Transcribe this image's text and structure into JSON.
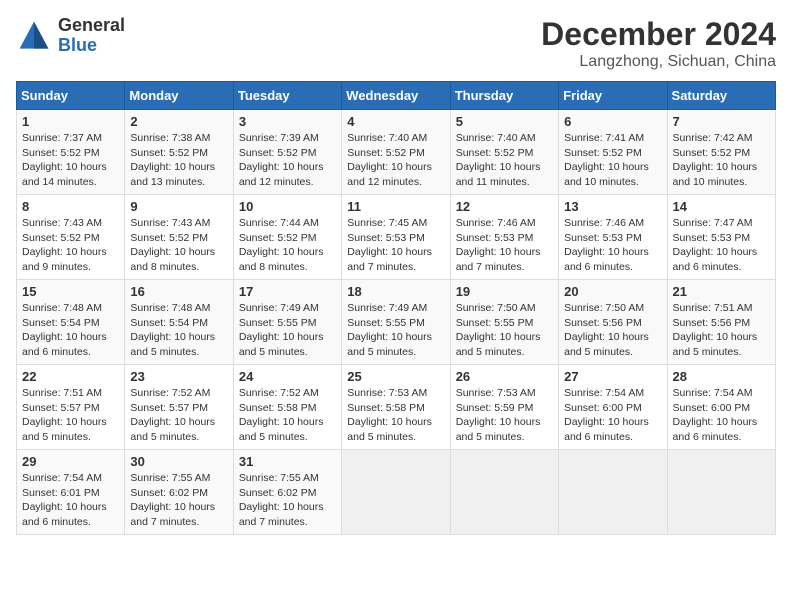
{
  "header": {
    "logo_general": "General",
    "logo_blue": "Blue",
    "month_title": "December 2024",
    "location": "Langzhong, Sichuan, China"
  },
  "weekdays": [
    "Sunday",
    "Monday",
    "Tuesday",
    "Wednesday",
    "Thursday",
    "Friday",
    "Saturday"
  ],
  "weeks": [
    [
      {
        "day": "1",
        "sunrise": "7:37 AM",
        "sunset": "5:52 PM",
        "daylight": "10 hours and 14 minutes."
      },
      {
        "day": "2",
        "sunrise": "7:38 AM",
        "sunset": "5:52 PM",
        "daylight": "10 hours and 13 minutes."
      },
      {
        "day": "3",
        "sunrise": "7:39 AM",
        "sunset": "5:52 PM",
        "daylight": "10 hours and 12 minutes."
      },
      {
        "day": "4",
        "sunrise": "7:40 AM",
        "sunset": "5:52 PM",
        "daylight": "10 hours and 12 minutes."
      },
      {
        "day": "5",
        "sunrise": "7:40 AM",
        "sunset": "5:52 PM",
        "daylight": "10 hours and 11 minutes."
      },
      {
        "day": "6",
        "sunrise": "7:41 AM",
        "sunset": "5:52 PM",
        "daylight": "10 hours and 10 minutes."
      },
      {
        "day": "7",
        "sunrise": "7:42 AM",
        "sunset": "5:52 PM",
        "daylight": "10 hours and 10 minutes."
      }
    ],
    [
      {
        "day": "8",
        "sunrise": "7:43 AM",
        "sunset": "5:52 PM",
        "daylight": "10 hours and 9 minutes."
      },
      {
        "day": "9",
        "sunrise": "7:43 AM",
        "sunset": "5:52 PM",
        "daylight": "10 hours and 8 minutes."
      },
      {
        "day": "10",
        "sunrise": "7:44 AM",
        "sunset": "5:52 PM",
        "daylight": "10 hours and 8 minutes."
      },
      {
        "day": "11",
        "sunrise": "7:45 AM",
        "sunset": "5:53 PM",
        "daylight": "10 hours and 7 minutes."
      },
      {
        "day": "12",
        "sunrise": "7:46 AM",
        "sunset": "5:53 PM",
        "daylight": "10 hours and 7 minutes."
      },
      {
        "day": "13",
        "sunrise": "7:46 AM",
        "sunset": "5:53 PM",
        "daylight": "10 hours and 6 minutes."
      },
      {
        "day": "14",
        "sunrise": "7:47 AM",
        "sunset": "5:53 PM",
        "daylight": "10 hours and 6 minutes."
      }
    ],
    [
      {
        "day": "15",
        "sunrise": "7:48 AM",
        "sunset": "5:54 PM",
        "daylight": "10 hours and 6 minutes."
      },
      {
        "day": "16",
        "sunrise": "7:48 AM",
        "sunset": "5:54 PM",
        "daylight": "10 hours and 5 minutes."
      },
      {
        "day": "17",
        "sunrise": "7:49 AM",
        "sunset": "5:55 PM",
        "daylight": "10 hours and 5 minutes."
      },
      {
        "day": "18",
        "sunrise": "7:49 AM",
        "sunset": "5:55 PM",
        "daylight": "10 hours and 5 minutes."
      },
      {
        "day": "19",
        "sunrise": "7:50 AM",
        "sunset": "5:55 PM",
        "daylight": "10 hours and 5 minutes."
      },
      {
        "day": "20",
        "sunrise": "7:50 AM",
        "sunset": "5:56 PM",
        "daylight": "10 hours and 5 minutes."
      },
      {
        "day": "21",
        "sunrise": "7:51 AM",
        "sunset": "5:56 PM",
        "daylight": "10 hours and 5 minutes."
      }
    ],
    [
      {
        "day": "22",
        "sunrise": "7:51 AM",
        "sunset": "5:57 PM",
        "daylight": "10 hours and 5 minutes."
      },
      {
        "day": "23",
        "sunrise": "7:52 AM",
        "sunset": "5:57 PM",
        "daylight": "10 hours and 5 minutes."
      },
      {
        "day": "24",
        "sunrise": "7:52 AM",
        "sunset": "5:58 PM",
        "daylight": "10 hours and 5 minutes."
      },
      {
        "day": "25",
        "sunrise": "7:53 AM",
        "sunset": "5:58 PM",
        "daylight": "10 hours and 5 minutes."
      },
      {
        "day": "26",
        "sunrise": "7:53 AM",
        "sunset": "5:59 PM",
        "daylight": "10 hours and 5 minutes."
      },
      {
        "day": "27",
        "sunrise": "7:54 AM",
        "sunset": "6:00 PM",
        "daylight": "10 hours and 6 minutes."
      },
      {
        "day": "28",
        "sunrise": "7:54 AM",
        "sunset": "6:00 PM",
        "daylight": "10 hours and 6 minutes."
      }
    ],
    [
      {
        "day": "29",
        "sunrise": "7:54 AM",
        "sunset": "6:01 PM",
        "daylight": "10 hours and 6 minutes."
      },
      {
        "day": "30",
        "sunrise": "7:55 AM",
        "sunset": "6:02 PM",
        "daylight": "10 hours and 7 minutes."
      },
      {
        "day": "31",
        "sunrise": "7:55 AM",
        "sunset": "6:02 PM",
        "daylight": "10 hours and 7 minutes."
      },
      null,
      null,
      null,
      null
    ]
  ]
}
